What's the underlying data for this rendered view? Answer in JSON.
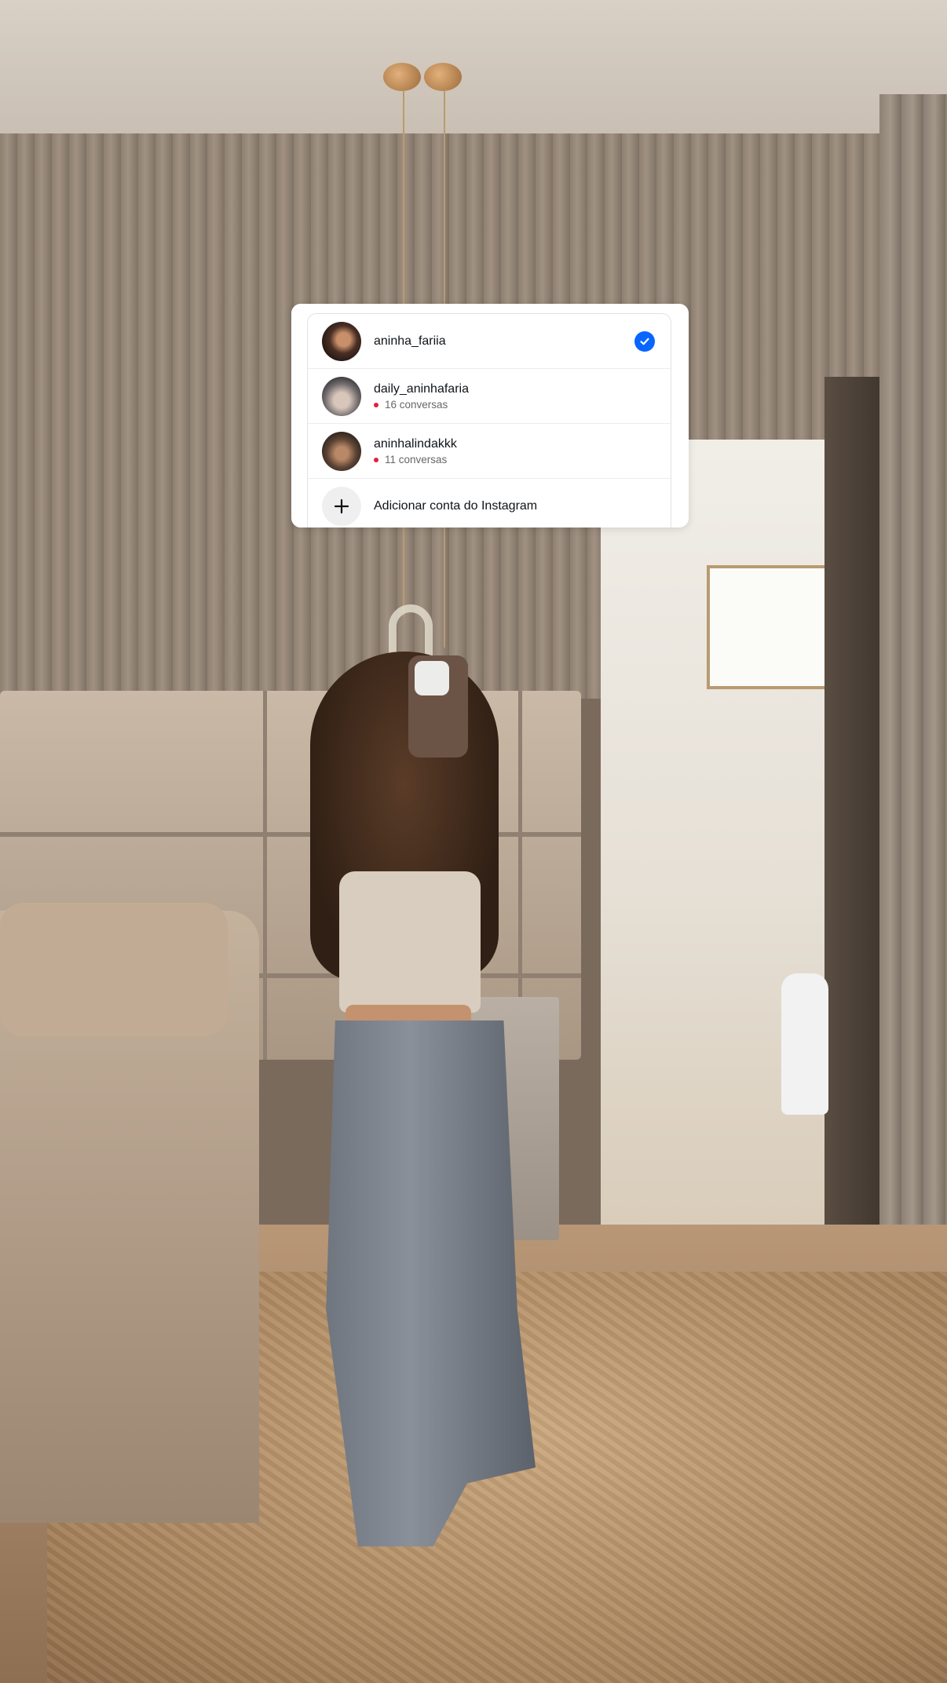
{
  "accounts": [
    {
      "username": "aninha_fariia",
      "selected": true,
      "avatar_icon": "profile-photo"
    },
    {
      "username": "daily_aninhafaria",
      "unread_label": "16 conversas",
      "avatar_icon": "profile-photo"
    },
    {
      "username": "aninhalindakkk",
      "unread_label": "11 conversas",
      "avatar_icon": "profile-photo"
    }
  ],
  "add_account": {
    "label": "Adicionar conta do Instagram",
    "icon": "plus-icon"
  },
  "colors": {
    "check": "#0866ff",
    "unread_dot": "#e41e3f",
    "card_bg": "#ffffff"
  }
}
